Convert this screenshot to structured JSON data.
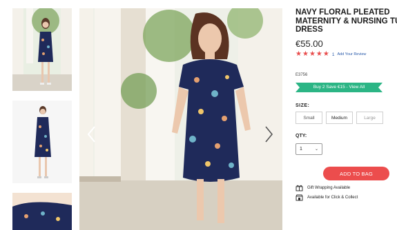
{
  "product": {
    "title_line1": "NAVY FLORAL PLEATED",
    "title_line2": "MATERNITY & NURSING TUNIC",
    "title_line3": "DRESS",
    "price": "€55.00",
    "rating_stars": 5,
    "review_count": "1",
    "review_link": "Add Your Review",
    "product_code": "E3756"
  },
  "promo": {
    "label": "Buy 2 Save €15 - View All",
    "color": "#2bb585"
  },
  "size": {
    "label": "SIZE:",
    "options": [
      "Small",
      "Medium",
      "Large"
    ]
  },
  "quantity": {
    "label": "QTY:",
    "value": "1"
  },
  "actions": {
    "add_to_bag": "ADD TO BAG",
    "button_color": "#ec4d4d"
  },
  "services": {
    "gift_wrapping": "Gift Wrapping Available",
    "click_collect": "Available for Click & Collect"
  },
  "colors": {
    "dress_navy": "#1f2a5a",
    "star_red": "#e84b4b"
  },
  "icons": {
    "prev": "chevron-left-icon",
    "next": "chevron-right-icon",
    "gift": "gift-icon",
    "store": "store-icon"
  }
}
